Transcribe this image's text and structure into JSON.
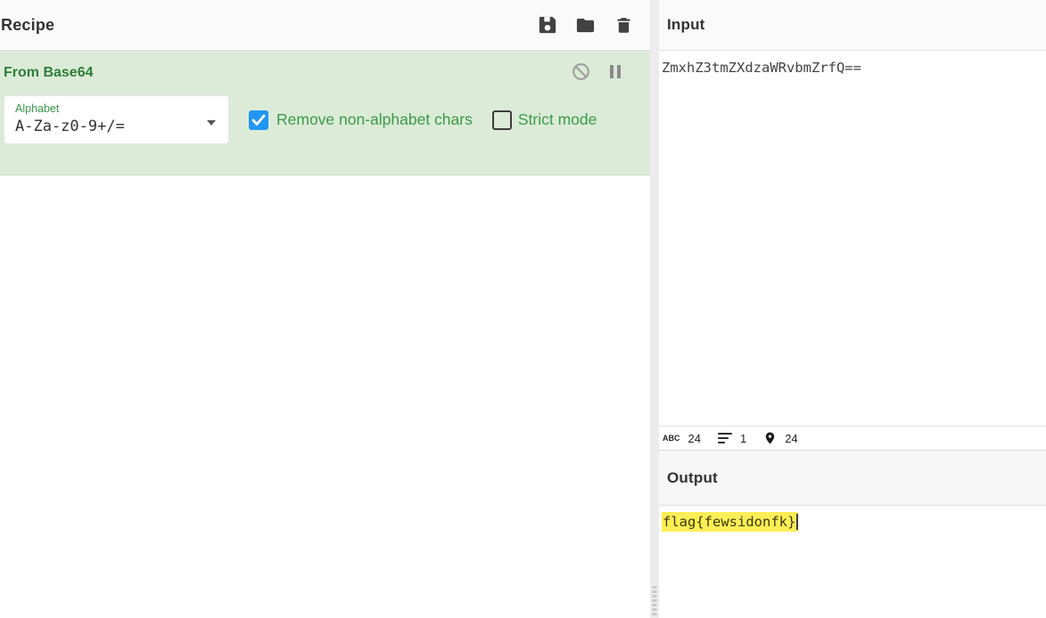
{
  "colors": {
    "accent_green": "#3a9a4c",
    "operation_background": "#dbebd7",
    "checkbox_blue": "#2196f3",
    "highlight_yellow": "#fdee57"
  },
  "recipe_panel": {
    "title": "Recipe",
    "toolbar": {
      "save_icon": "floppy-disk",
      "load_icon": "folder",
      "clear_icon": "trash"
    },
    "operation": {
      "title": "From Base64",
      "controls": {
        "disable_icon": "circle-slash",
        "breakpoint_icon": "pause"
      },
      "args": {
        "alphabet": {
          "label": "Alphabet",
          "value": "A-Za-z0-9+/="
        },
        "remove_non_alphabet": {
          "label": "Remove non-alphabet chars",
          "checked": true
        },
        "strict_mode": {
          "label": "Strict mode",
          "checked": false
        }
      }
    }
  },
  "input_panel": {
    "title": "Input",
    "content": "ZmxhZ3tmZXdzaWRvbmZrfQ==",
    "status_bar": {
      "char_count": "24",
      "line_count": "1",
      "cursor_position": "24",
      "char_count_icon": "abc",
      "line_count_icon": "lines",
      "cursor_position_icon": "location-pin"
    }
  },
  "output_panel": {
    "title": "Output",
    "content": "flag{fewsidonfk}"
  }
}
